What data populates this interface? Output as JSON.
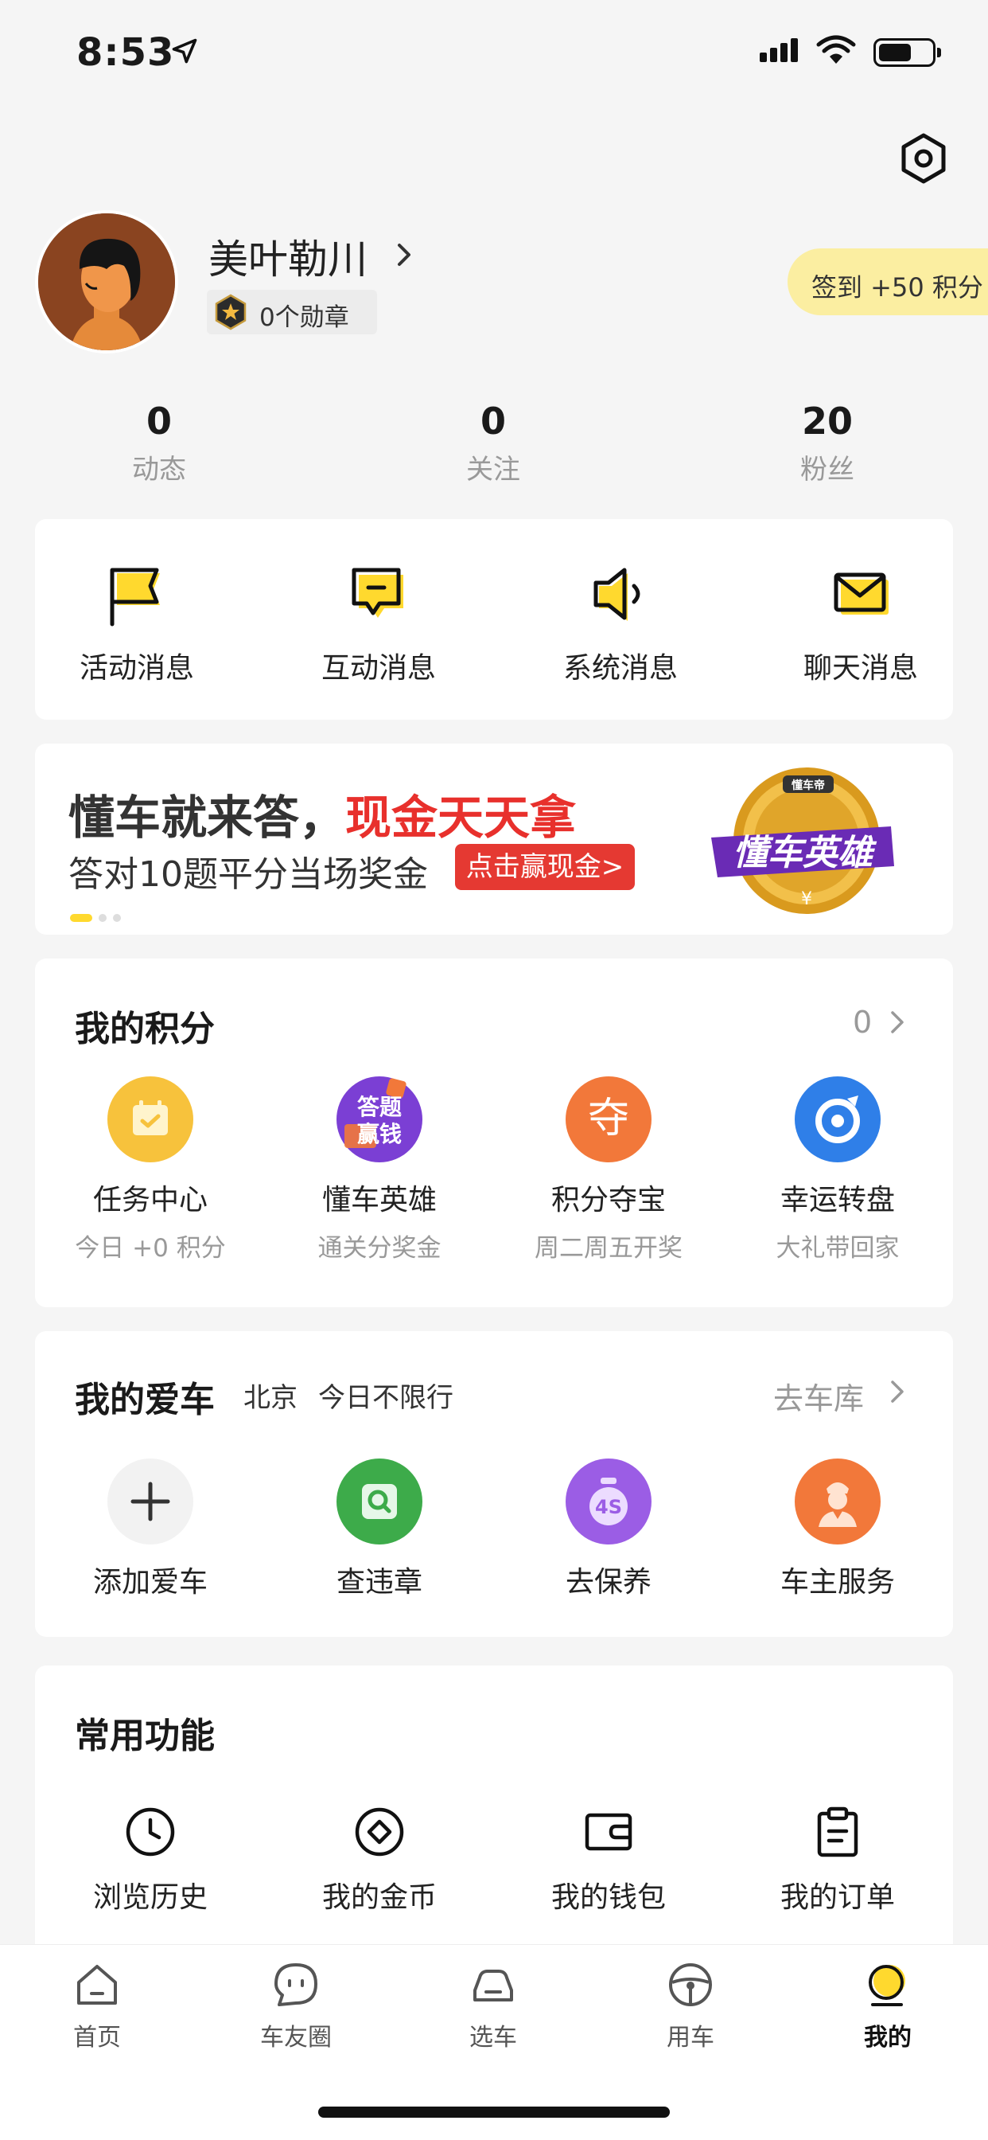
{
  "status_bar": {
    "time": "8:53"
  },
  "profile": {
    "username": "美叶勒川",
    "badge_label": "0个勋章",
    "checkin_label": "签到 +50 积分"
  },
  "stats": [
    {
      "value": "0",
      "label": "动态"
    },
    {
      "value": "0",
      "label": "关注"
    },
    {
      "value": "20",
      "label": "粉丝"
    }
  ],
  "messages": [
    {
      "label": "活动消息",
      "icon": "flag-icon"
    },
    {
      "label": "互动消息",
      "icon": "chat-bubble-icon"
    },
    {
      "label": "系统消息",
      "icon": "speaker-icon"
    },
    {
      "label": "聊天消息",
      "icon": "envelope-icon"
    }
  ],
  "banner": {
    "line1_prefix": "懂车就来答，",
    "line1_highlight": "现金天天拿",
    "line2": "答对10题平分当场奖金",
    "cta": "点击赢现金>",
    "logo_top": "懂车帝",
    "logo_main": "懂车英雄",
    "logo_symbol": "¥"
  },
  "points": {
    "title": "我的积分",
    "value": "0",
    "items": [
      {
        "label": "任务中心",
        "sub": "今日 +0 积分",
        "icon": "calendar-check-icon",
        "color": "#f7c23c"
      },
      {
        "label": "懂车英雄",
        "sub": "通关分奖金",
        "icon": "quiz-icon",
        "color": "#7b3fd4",
        "badge_top": "答题",
        "badge_bottom": "赢钱"
      },
      {
        "label": "积分夺宝",
        "sub": "周二周五开奖",
        "icon": "treasure-icon",
        "color": "#f2783a",
        "glyph": "夺"
      },
      {
        "label": "幸运转盘",
        "sub": "大礼带回家",
        "icon": "spin-wheel-icon",
        "color": "#2f7fe8"
      }
    ]
  },
  "car": {
    "title": "我的爱车",
    "city": "北京",
    "restriction": "今日不限行",
    "garage_link": "去车库",
    "items": [
      {
        "label": "添加爱车",
        "icon": "plus-icon",
        "color": "#f2f2f2"
      },
      {
        "label": "查违章",
        "icon": "violation-search-icon",
        "color": "#3dab4a"
      },
      {
        "label": "去保养",
        "icon": "maintenance-4s-icon",
        "color": "#9b5de5",
        "glyph": "4S"
      },
      {
        "label": "车主服务",
        "icon": "owner-service-icon",
        "color": "#f2783a"
      }
    ]
  },
  "functions": {
    "title": "常用功能",
    "items": [
      {
        "label": "浏览历史",
        "icon": "clock-icon"
      },
      {
        "label": "我的金币",
        "icon": "coin-icon"
      },
      {
        "label": "我的钱包",
        "icon": "wallet-icon"
      },
      {
        "label": "我的订单",
        "icon": "clipboard-icon"
      }
    ]
  },
  "tabs": [
    {
      "label": "首页",
      "icon": "home-icon",
      "active": false
    },
    {
      "label": "车友圈",
      "icon": "community-icon",
      "active": false
    },
    {
      "label": "选车",
      "icon": "car-select-icon",
      "active": false
    },
    {
      "label": "用车",
      "icon": "steering-wheel-icon",
      "active": false
    },
    {
      "label": "我的",
      "icon": "profile-icon",
      "active": true
    }
  ],
  "colors": {
    "accent_yellow": "#ffd92e",
    "background": "#f5f5f5",
    "promo_red": "#e8302c"
  }
}
